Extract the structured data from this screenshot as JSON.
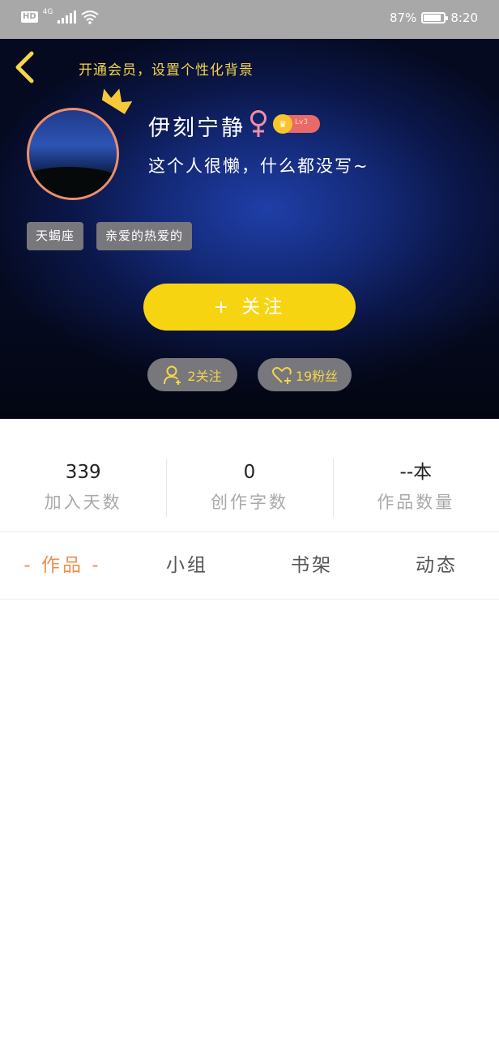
{
  "status_bar": {
    "hd": "HD",
    "network": "4G",
    "battery": "87%",
    "time": "8:20"
  },
  "profile": {
    "vip_promo": "开通会员，设置个性化背景",
    "username": "伊刻宁静",
    "level": "Lv3",
    "bio": "这个人很懒，什么都没写~",
    "tags": [
      "天蝎座",
      "亲爱的热爱的"
    ],
    "follow_label": "关注",
    "following_label": "2关注",
    "fans_label": "19粉丝"
  },
  "stats": [
    {
      "value": "339",
      "label": "加入天数"
    },
    {
      "value": "0",
      "label": "创作字数"
    },
    {
      "value": "--本",
      "label": "作品数量"
    }
  ],
  "tabs": [
    {
      "label": "- 作品 -",
      "active": true
    },
    {
      "label": "小组",
      "active": false
    },
    {
      "label": "书架",
      "active": false
    },
    {
      "label": "动态",
      "active": false
    }
  ],
  "colors": {
    "accent_yellow": "#f7d411",
    "active_tab": "#ef8e4f",
    "avatar_border": "#ee8f6a",
    "status_bar": "#a8a8a8"
  }
}
